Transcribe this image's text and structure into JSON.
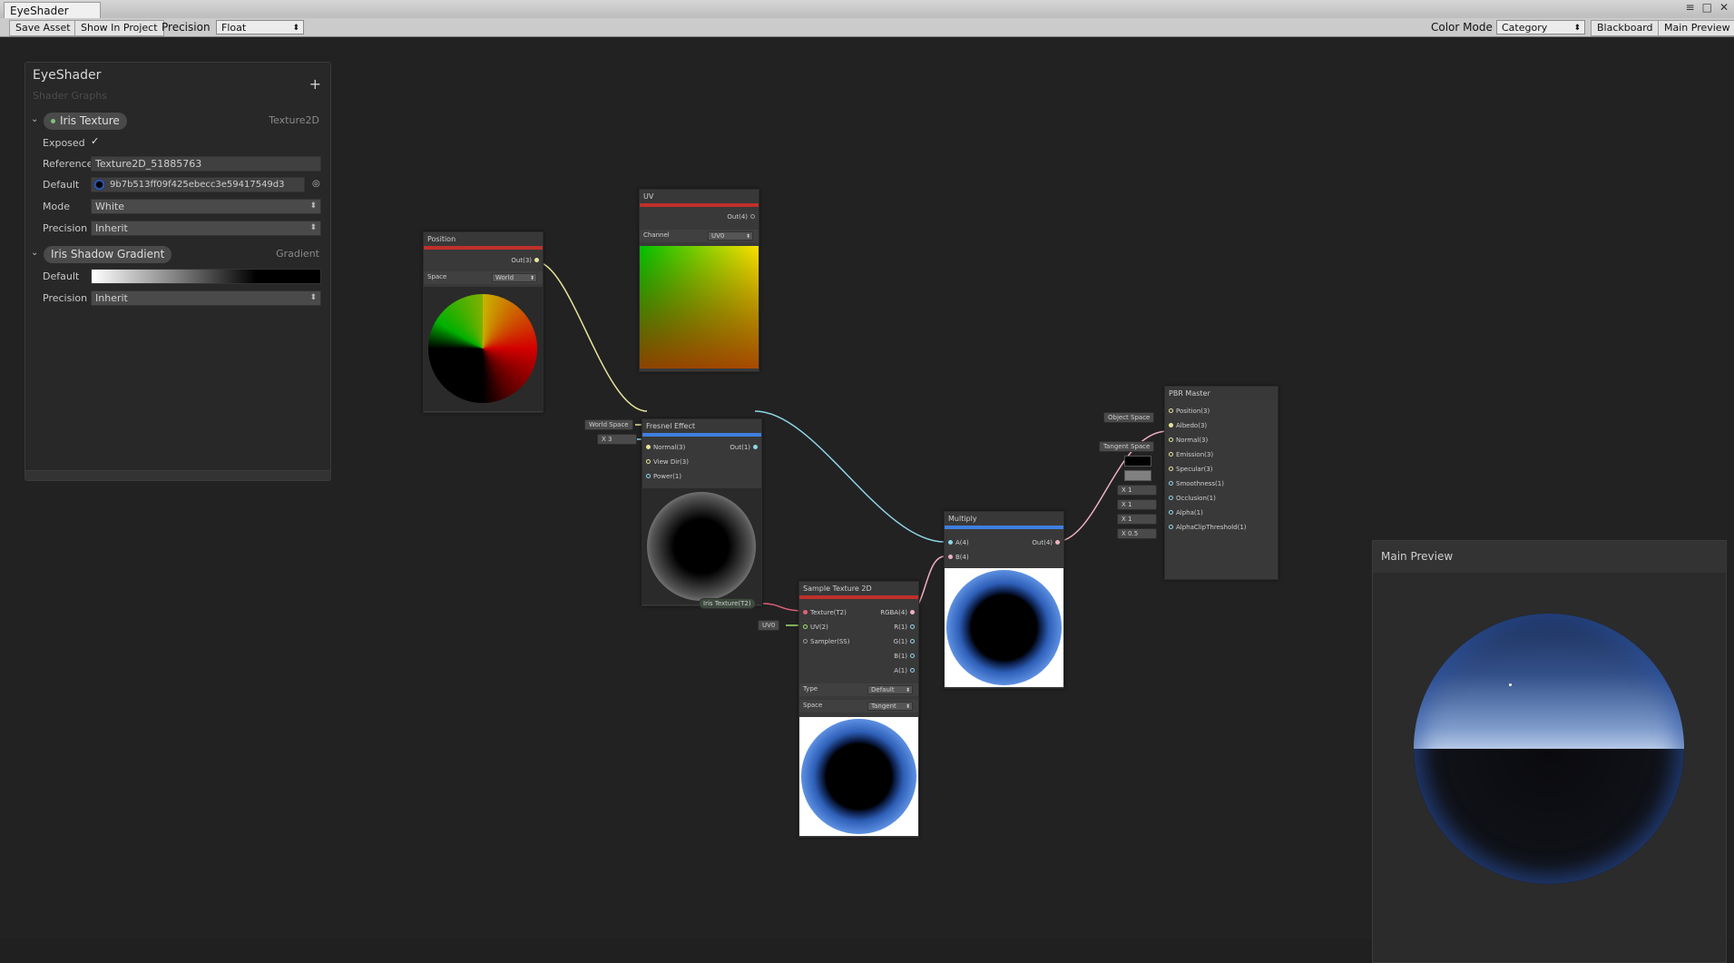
{
  "window": {
    "tab_title": "EyeShader",
    "controls": [
      "≡",
      "□",
      "✕"
    ]
  },
  "toolbar": {
    "save_asset": "Save Asset",
    "show_in_project": "Show In Project",
    "precision_label": "Precision",
    "precision_value": "Float",
    "color_mode_label": "Color Mode",
    "color_mode_value": "Category",
    "blackboard": "Blackboard",
    "main_preview": "Main Preview"
  },
  "blackboard": {
    "title": "EyeShader",
    "subtitle": "Shader Graphs",
    "add_icon": "+",
    "properties": [
      {
        "name": "Iris Texture",
        "type": "Texture2D",
        "exposed_label": "Exposed",
        "exposed": "✓",
        "reference_label": "Reference",
        "reference": "Texture2D_51885763",
        "default_label": "Default",
        "default": "9b7b513ff09f425ebecc3e59417549d3",
        "mode_label": "Mode",
        "mode": "White",
        "precision_label": "Precision",
        "precision": "Inherit"
      },
      {
        "name": "Iris Shadow Gradient",
        "type": "Gradient",
        "default_label": "Default",
        "precision_label": "Precision",
        "precision": "Inherit"
      }
    ]
  },
  "nodes": {
    "position": {
      "title": "Position",
      "out": "Out(3)",
      "space_label": "Space",
      "space": "World"
    },
    "uv": {
      "title": "UV",
      "out": "Out(4)",
      "channel_label": "Channel",
      "channel": "UV0"
    },
    "fresnel": {
      "title": "Fresnel Effect",
      "inputs": [
        "Normal(3)",
        "View Dir(3)",
        "Power(1)"
      ],
      "out": "Out(1)",
      "chip_world_space": "World Space",
      "chip_power": "X  3"
    },
    "multiply": {
      "title": "Multiply",
      "inputs": [
        "A(4)",
        "B(4)"
      ],
      "out": "Out(4)"
    },
    "sample": {
      "title": "Sample Texture 2D",
      "inputs": [
        "Texture(T2)",
        "UV(2)",
        "Sampler(SS)"
      ],
      "outputs": [
        "RGBA(4)",
        "R(1)",
        "G(1)",
        "B(1)",
        "A(1)"
      ],
      "type_label": "Type",
      "type": "Default",
      "space_label": "Space",
      "space": "Tangent",
      "chip_texture": "Iris Texture(T2)",
      "chip_uv": "UV0"
    },
    "pbr": {
      "title": "PBR Master",
      "inputs": [
        "Position(3)",
        "Albedo(3)",
        "Normal(3)",
        "Emission(3)",
        "Specular(3)",
        "Smoothness(1)",
        "Occlusion(1)",
        "Alpha(1)",
        "AlphaClipThreshold(1)"
      ],
      "chip_object_space": "Object Space",
      "chip_tangent_space": "Tangent Space",
      "chip_smoothness": "X  1",
      "chip_occlusion": "X  1",
      "chip_alpha": "X  1",
      "chip_alphaclip": "X  0.5"
    }
  },
  "main_preview": {
    "title": "Main Preview"
  },
  "colors": {
    "header_red": "#c0302a",
    "header_blue": "#3f7fe0",
    "canvas": "#222222"
  }
}
